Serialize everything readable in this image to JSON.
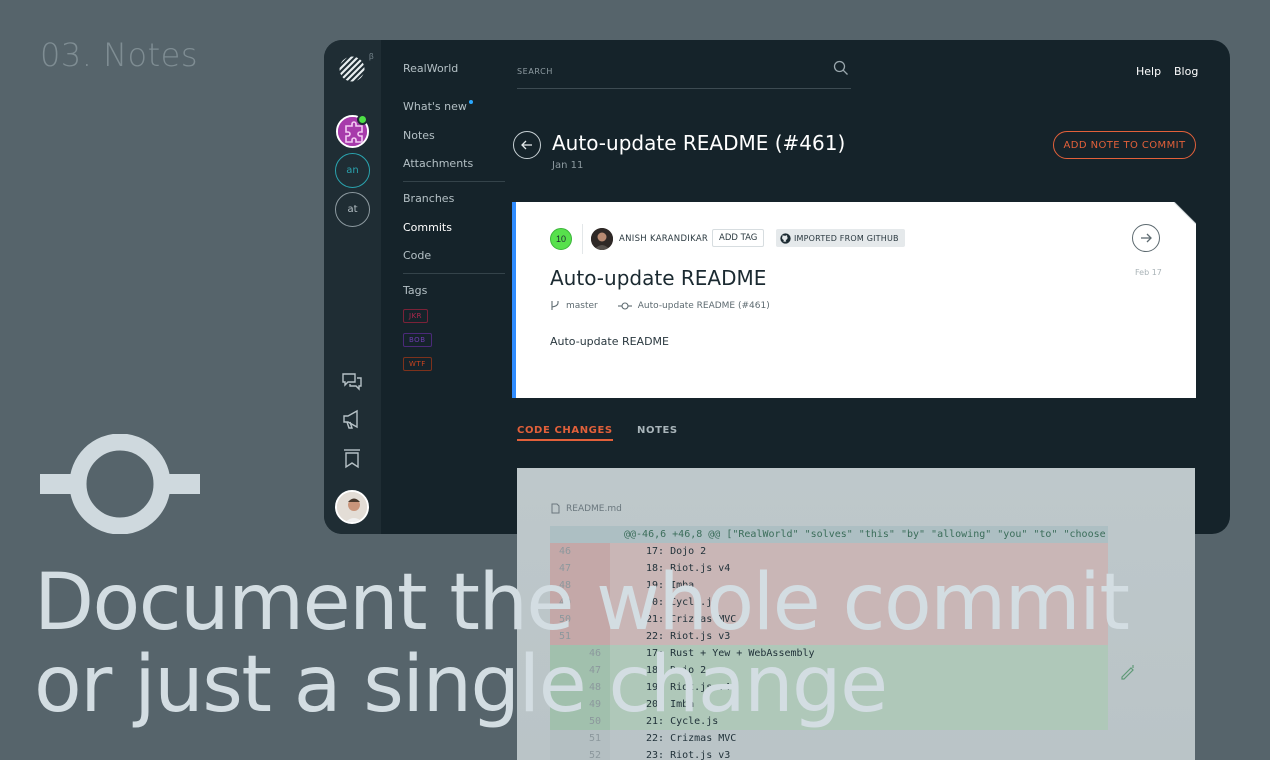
{
  "step_label": "03. Notes",
  "headline": {
    "line1": "Document the whole commit",
    "line2": "or just a single change"
  },
  "rail": {
    "beta": "β",
    "circle_buttons": [
      "an",
      "at"
    ],
    "icons": [
      "chat-icon",
      "megaphone-icon",
      "bookmark-icon"
    ]
  },
  "sidebar": {
    "project": "RealWorld",
    "items": [
      {
        "label": "What's new"
      },
      {
        "label": "Notes"
      },
      {
        "label": "Attachments"
      },
      {
        "label": "Branches"
      },
      {
        "label": "Commits"
      },
      {
        "label": "Code"
      }
    ],
    "tags_header": "Tags",
    "tags": [
      {
        "label": "JKR",
        "color": "#b0274d"
      },
      {
        "label": "BOB",
        "color": "#6e3bb0"
      },
      {
        "label": "WTF",
        "color": "#c8431f"
      }
    ]
  },
  "search": {
    "placeholder": "SEARCH"
  },
  "top_links": {
    "help": "Help",
    "blog": "Blog"
  },
  "commit": {
    "title": "Auto-update README (#461)",
    "date": "Jan 11",
    "add_note_label": "ADD NOTE TO COMMIT"
  },
  "card": {
    "count": "10",
    "author": "ANISH KARANDIKAR",
    "add_tag": "ADD TAG",
    "imported": "IMPORTED FROM GITHUB",
    "date": "Feb 17",
    "title": "Auto-update README",
    "branch": "master",
    "commit_ref": "Auto-update README (#461)",
    "body": "Auto-update README"
  },
  "tabs": [
    {
      "label": "CODE CHANGES",
      "active": true
    },
    {
      "label": "NOTES",
      "active": false
    }
  ],
  "code": {
    "file": "README.md",
    "hunk": "@@-46,6 +46,8 @@ [\"RealWorld\" \"solves\" \"this\" \"by\" \"allowing\" \"you\" \"to\" \"choose",
    "lines": [
      {
        "old": "46",
        "new": "",
        "text": "17: Dojo 2",
        "type": "del"
      },
      {
        "old": "47",
        "new": "",
        "text": "18: Riot.js v4",
        "type": "del"
      },
      {
        "old": "48",
        "new": "",
        "text": "19: Imba",
        "type": "del"
      },
      {
        "old": "49",
        "new": "",
        "text": "20: Cycle.js",
        "type": "del"
      },
      {
        "old": "50",
        "new": "",
        "text": "21: Crizmas MVC",
        "type": "del"
      },
      {
        "old": "51",
        "new": "",
        "text": "22: Riot.js v3",
        "type": "del"
      },
      {
        "old": "",
        "new": "46",
        "text": "17: Rust + Yew + WebAssembly",
        "type": "add"
      },
      {
        "old": "",
        "new": "47",
        "text": "18: Dojo 2",
        "type": "add"
      },
      {
        "old": "",
        "new": "48",
        "text": "19: Riot.js v4",
        "type": "add"
      },
      {
        "old": "",
        "new": "49",
        "text": "20: Imba",
        "type": "add"
      },
      {
        "old": "",
        "new": "50",
        "text": "21: Cycle.js",
        "type": "add"
      },
      {
        "old": "",
        "new": "51",
        "text": "22: Crizmas MVC",
        "type": "ctx"
      },
      {
        "old": "",
        "new": "52",
        "text": "23: Riot.js v3",
        "type": "ctx"
      }
    ]
  },
  "colors": {
    "accent": "#e2603a",
    "card_border": "#2f8cff",
    "badge_green": "#57e14c",
    "background": "#56646b",
    "app_bg": "#15232a"
  }
}
